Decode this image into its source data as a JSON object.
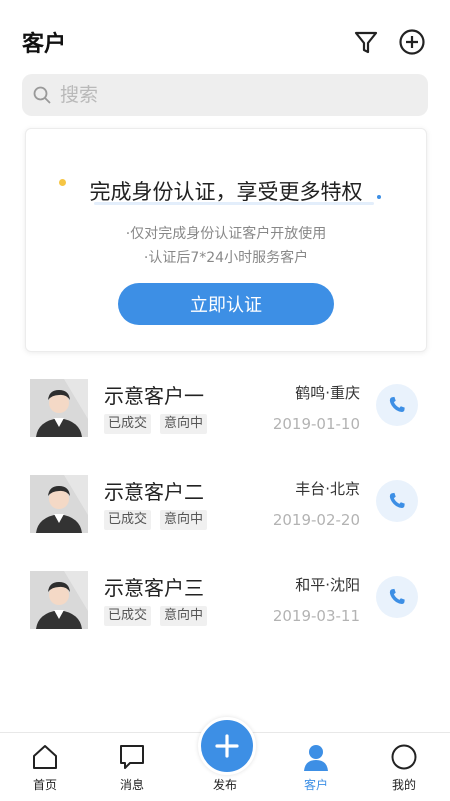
{
  "header": {
    "title": "客户",
    "filter_icon": "filter-icon",
    "add_icon": "add-circle-icon"
  },
  "search": {
    "placeholder": "搜索",
    "value": "",
    "icon": "search-icon"
  },
  "verify_card": {
    "headline": "完成身份认证，享受更多特权",
    "line1": "·仅对完成身份认证客户开放使用",
    "line2": "·认证后7*24小时服务客户",
    "button_label": "立即认证"
  },
  "customers": [
    {
      "name": "示意客户一",
      "tags": [
        "已成交",
        "意向中"
      ],
      "location": "鹤鸣·重庆",
      "date": "2019-01-10"
    },
    {
      "name": "示意客户二",
      "tags": [
        "已成交",
        "意向中"
      ],
      "location": "丰台·北京",
      "date": "2019-02-20"
    },
    {
      "name": "示意客户三",
      "tags": [
        "已成交",
        "意向中"
      ],
      "location": "和平·沈阳",
      "date": "2019-03-11"
    }
  ],
  "tabbar": {
    "items": [
      {
        "label": "首页",
        "icon": "home-icon"
      },
      {
        "label": "消息",
        "icon": "message-icon"
      },
      {
        "label": "发布",
        "icon": "plus-icon"
      },
      {
        "label": "客户",
        "icon": "person-icon",
        "active": true
      },
      {
        "label": "我的",
        "icon": "circle-icon"
      }
    ]
  },
  "colors": {
    "accent": "#3d8fe5",
    "dot_yellow": "#f6c544",
    "tag_bg": "#f0f0f0",
    "call_bg": "#e9f2fc"
  }
}
